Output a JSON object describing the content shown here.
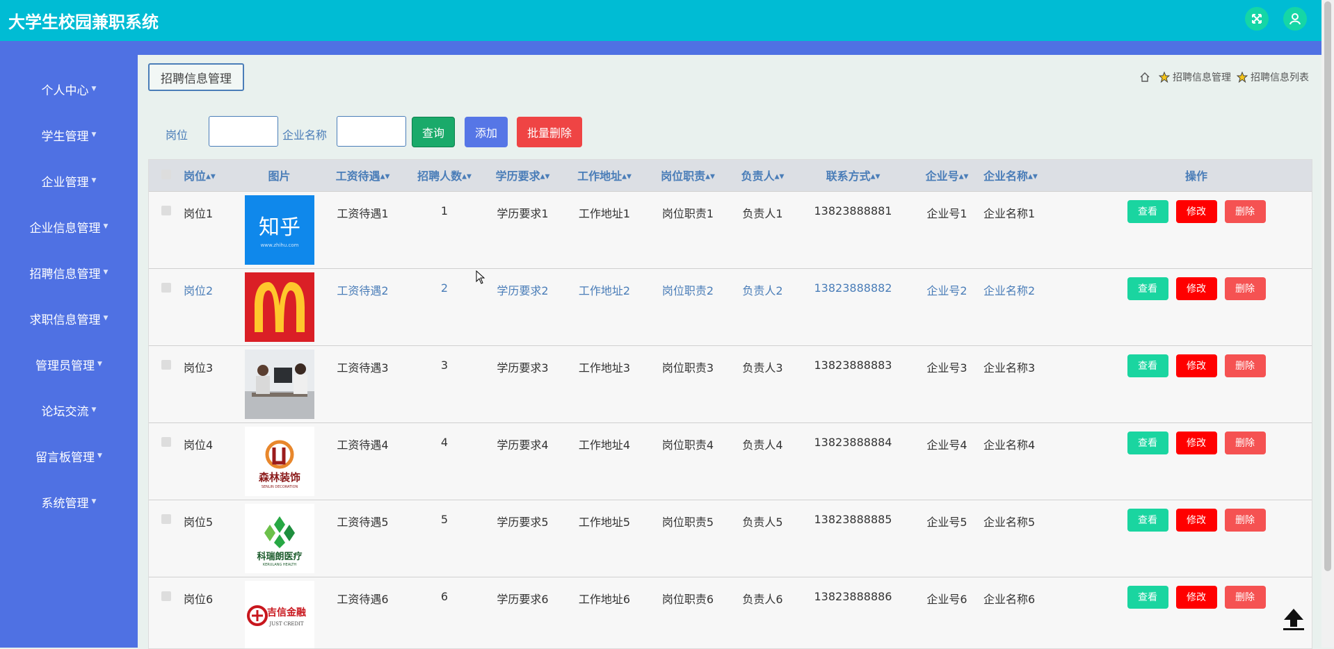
{
  "header": {
    "title": "大学生校园兼职系统"
  },
  "sidebar": {
    "items": [
      {
        "label": "个人中心"
      },
      {
        "label": "学生管理"
      },
      {
        "label": "企业管理"
      },
      {
        "label": "企业信息管理"
      },
      {
        "label": "招聘信息管理"
      },
      {
        "label": "求职信息管理"
      },
      {
        "label": "管理员管理"
      },
      {
        "label": "论坛交流"
      },
      {
        "label": "留言板管理"
      },
      {
        "label": "系统管理"
      }
    ]
  },
  "page": {
    "tab": "招聘信息管理",
    "breadcrumb": [
      "招聘信息管理",
      "招聘信息列表"
    ]
  },
  "search": {
    "label_position": "岗位",
    "label_company": "企业名称",
    "query": "查询",
    "add": "添加",
    "batch_delete": "批量删除"
  },
  "table": {
    "headers": {
      "position": "岗位",
      "image": "图片",
      "salary": "工资待遇",
      "count": "招聘人数",
      "education": "学历要求",
      "address": "工作地址",
      "duty": "岗位职责",
      "manager": "负责人",
      "contact": "联系方式",
      "company_no": "企业号",
      "company_name": "企业名称",
      "actions": "操作"
    },
    "ops": {
      "view": "查看",
      "edit": "修改",
      "delete": "删除"
    },
    "rows": [
      {
        "position": "岗位1",
        "image": "zhihu-logo",
        "salary": "工资待遇1",
        "count": "1",
        "education": "学历要求1",
        "address": "工作地址1",
        "duty": "岗位职责1",
        "manager": "负责人1",
        "contact": "13823888881",
        "company_no": "企业号1",
        "company_name": "企业名称1"
      },
      {
        "position": "岗位2",
        "image": "mcdonalds-logo",
        "salary": "工资待遇2",
        "count": "2",
        "education": "学历要求2",
        "address": "工作地址2",
        "duty": "岗位职责2",
        "manager": "负责人2",
        "contact": "13823888882",
        "company_no": "企业号2",
        "company_name": "企业名称2"
      },
      {
        "position": "岗位3",
        "image": "office-meeting-photo",
        "salary": "工资待遇3",
        "count": "3",
        "education": "学历要求3",
        "address": "工作地址3",
        "duty": "岗位职责3",
        "manager": "负责人3",
        "contact": "13823888883",
        "company_no": "企业号3",
        "company_name": "企业名称3"
      },
      {
        "position": "岗位4",
        "image": "senlin-decoration-logo",
        "salary": "工资待遇4",
        "count": "4",
        "education": "学历要求4",
        "address": "工作地址4",
        "duty": "岗位职责4",
        "manager": "负责人4",
        "contact": "13823888884",
        "company_no": "企业号4",
        "company_name": "企业名称4"
      },
      {
        "position": "岗位5",
        "image": "kerulang-health-logo",
        "salary": "工资待遇5",
        "count": "5",
        "education": "学历要求5",
        "address": "工作地址5",
        "duty": "岗位职责5",
        "manager": "负责人5",
        "contact": "13823888885",
        "company_no": "企业号5",
        "company_name": "企业名称5"
      },
      {
        "position": "岗位6",
        "image": "just-credit-logo",
        "salary": "工资待遇6",
        "count": "6",
        "education": "学历要求6",
        "address": "工作地址6",
        "duty": "岗位职责6",
        "manager": "负责人6",
        "contact": "13823888886",
        "company_no": "企业号6",
        "company_name": "企业名称6"
      }
    ]
  },
  "logos": {
    "zhihu_text": "知乎",
    "zhihu_url": "www.zhihu.com",
    "senlin_cn": "森林装饰",
    "senlin_en": "SENLIN DECORATION",
    "kerulang_cn": "科瑞朗医疗",
    "kerulang_en": "KERULANG HEALTH",
    "jixin_cn": "吉信金融",
    "jixin_en": "JUST CREDIT"
  },
  "colors": {
    "header": "#00bcd4",
    "sidebar": "#4f71e3",
    "view": "#1ad5a0",
    "edit": "#ff0000",
    "delete": "#f55252",
    "link": "#4a7db8"
  }
}
